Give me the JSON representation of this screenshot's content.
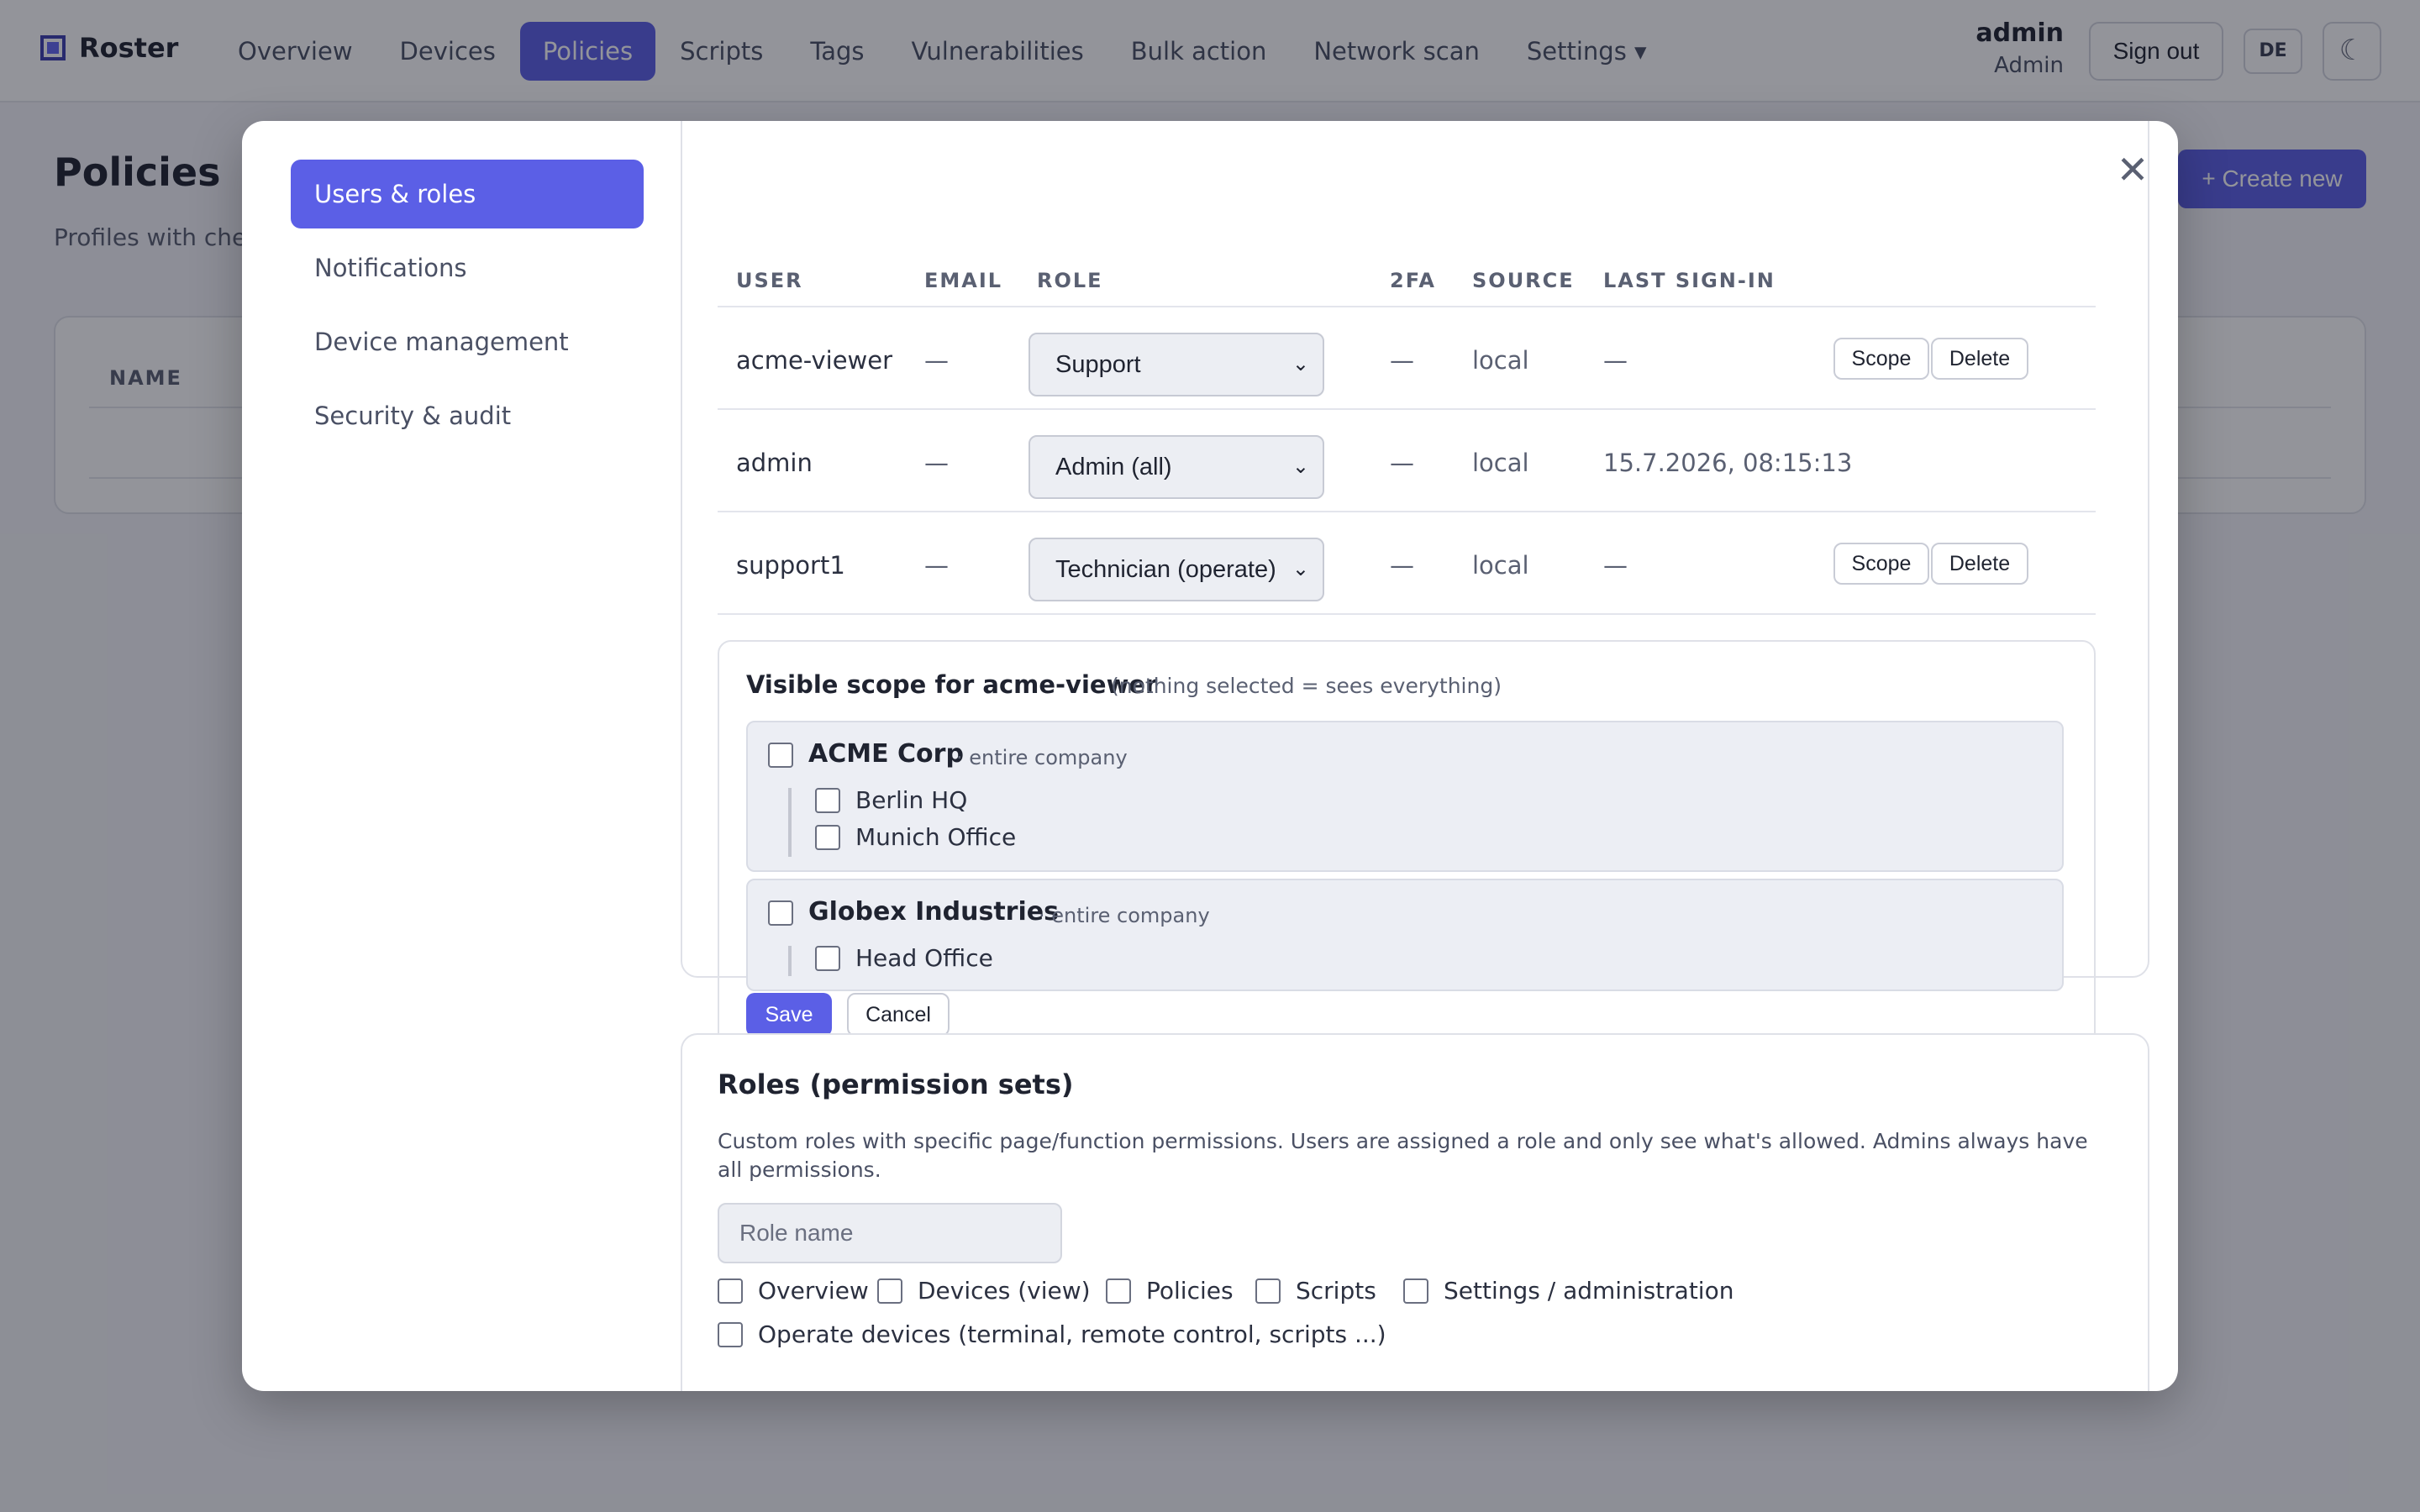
{
  "app": {
    "name": "Roster"
  },
  "nav": {
    "items": [
      {
        "label": "Overview"
      },
      {
        "label": "Devices"
      },
      {
        "label": "Policies"
      },
      {
        "label": "Scripts"
      },
      {
        "label": "Tags"
      },
      {
        "label": "Vulnerabilities"
      },
      {
        "label": "Bulk action"
      },
      {
        "label": "Network scan"
      },
      {
        "label": "Settings ▾"
      }
    ],
    "active": "Policies"
  },
  "user": {
    "name": "admin",
    "role": "Admin"
  },
  "header_actions": {
    "sign_out": "Sign out",
    "language": "DE",
    "theme_icon": "☾"
  },
  "page": {
    "title": "Policies",
    "subtitle": "Profiles with chec",
    "create_button": "+ Create new",
    "table_header_name": "NAME"
  },
  "modal": {
    "close_icon": "✕",
    "sidebar": [
      {
        "label": "Users & roles"
      },
      {
        "label": "Notifications"
      },
      {
        "label": "Device management"
      },
      {
        "label": "Security & audit"
      }
    ],
    "users_table": {
      "headers": [
        "USER",
        "EMAIL",
        "ROLE",
        "2FA",
        "SOURCE",
        "LAST SIGN-IN"
      ],
      "rows": [
        {
          "user": "acme-viewer",
          "email": "—",
          "role": "Support",
          "twofa": "—",
          "source": "local",
          "last_sign_in": "—",
          "scope": "Scope",
          "delete": "Delete"
        },
        {
          "user": "admin",
          "email": "—",
          "role": "Admin (all)",
          "twofa": "—",
          "source": "local",
          "last_sign_in": "15.7.2026, 08:15:13"
        },
        {
          "user": "support1",
          "email": "—",
          "role": "Technician (operate)",
          "twofa": "—",
          "source": "local",
          "last_sign_in": "—",
          "scope": "Scope",
          "delete": "Delete"
        }
      ]
    },
    "scope": {
      "title": "Visible scope for acme-viewer",
      "hint": "(nothing selected = sees everything)",
      "companies": [
        {
          "name": "ACME Corp",
          "note": "· entire company",
          "locations": [
            "Berlin HQ",
            "Munich Office"
          ]
        },
        {
          "name": "Globex Industries",
          "note": "· entire company",
          "locations": [
            "Head Office"
          ]
        }
      ],
      "save": "Save",
      "cancel": "Cancel"
    },
    "roles": {
      "title": "Roles (permission sets)",
      "description": "Custom roles with specific page/function permissions. Users are assigned a role and only see what's allowed. Admins always have all permissions.",
      "name_placeholder": "Role name",
      "permissions": [
        "Overview",
        "Devices (view)",
        "Policies",
        "Scripts",
        "Settings / administration",
        "Operate devices (terminal, remote control, scripts ...)"
      ]
    }
  },
  "colors": {
    "accent": "#5b5fe6",
    "overlay": "rgba(15,18,30,0.45)"
  }
}
